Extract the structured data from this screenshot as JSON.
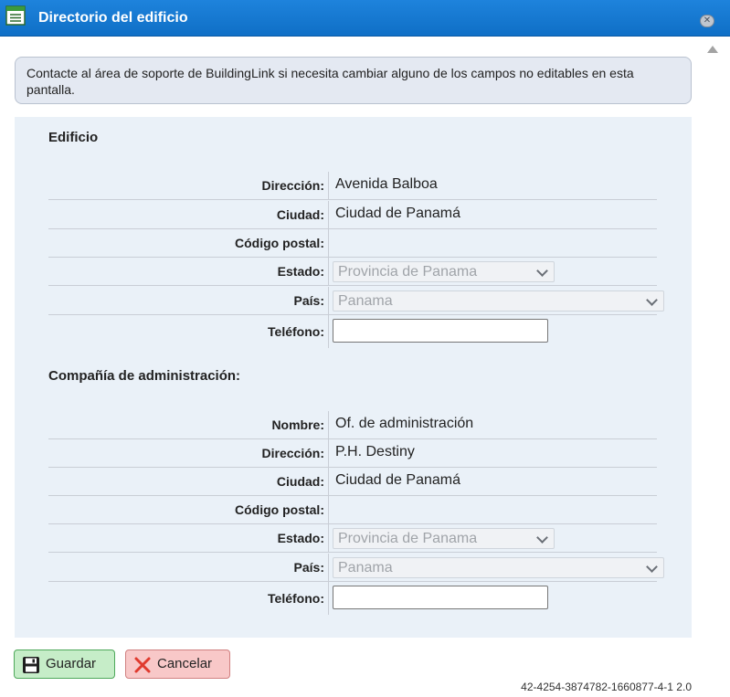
{
  "window": {
    "title": "Directorio del edificio",
    "close_symbol": "✕"
  },
  "notice": "Contacte al área de soporte de BuildingLink si necesita cambiar alguno de los campos no editables en esta pantalla.",
  "building": {
    "section_title": "Edificio",
    "rows": {
      "direccion": {
        "label": "Dirección:",
        "value": "Avenida Balboa"
      },
      "ciudad": {
        "label": "Ciudad:",
        "value": "Ciudad de Panamá"
      },
      "postal": {
        "label": "Código postal:",
        "value": ""
      },
      "estado": {
        "label": "Estado:",
        "value": "Provincia de Panama"
      },
      "pais": {
        "label": "País:",
        "value": "Panama"
      },
      "telefono": {
        "label": "Teléfono:",
        "value": ""
      }
    }
  },
  "management": {
    "section_title": "Compañía de administración:",
    "rows": {
      "nombre": {
        "label": "Nombre:",
        "value": "Of. de administración"
      },
      "direccion": {
        "label": "Dirección:",
        "value": "P.H. Destiny"
      },
      "ciudad": {
        "label": "Ciudad:",
        "value": "Ciudad de Panamá"
      },
      "postal": {
        "label": "Código postal:",
        "value": ""
      },
      "estado": {
        "label": "Estado:",
        "value": "Provincia de Panama"
      },
      "pais": {
        "label": "País:",
        "value": "Panama"
      },
      "telefono": {
        "label": "Teléfono:",
        "value": ""
      }
    }
  },
  "buttons": {
    "save": {
      "label": "Guardar",
      "icon": "save-icon"
    },
    "cancel": {
      "label": "Cancelar",
      "icon": "cancel-x-icon"
    }
  },
  "footer_id": "42-4254-3874782-1660877-4-1 2.0",
  "colors": {
    "titlebar": "#1676d2",
    "panel": "#eaf1f8",
    "save_bg": "#c6edc8",
    "cancel_bg": "#f8c8c8",
    "cancel_x": "#e03a2e"
  }
}
